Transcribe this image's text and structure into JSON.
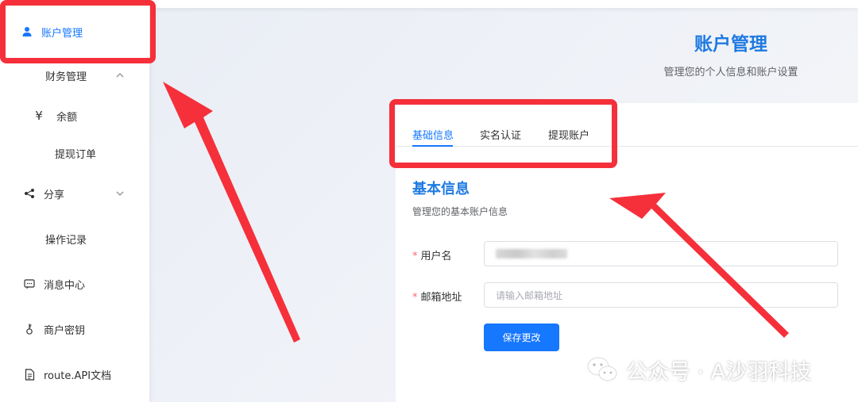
{
  "sidebar": {
    "items": [
      {
        "label": "账户管理",
        "icon": "user-icon",
        "active": true
      },
      {
        "label": "财务管理",
        "icon": "",
        "expandable": true,
        "expanded": true
      },
      {
        "label": "余额",
        "icon": "yen-icon",
        "glyph": "¥"
      },
      {
        "label": "提现订单",
        "icon": ""
      },
      {
        "label": "分享",
        "icon": "share-icon",
        "expandable": true,
        "expanded": false
      },
      {
        "label": "操作记录",
        "icon": ""
      },
      {
        "label": "消息中心",
        "icon": "message-icon"
      },
      {
        "label": "商户密钥",
        "icon": "key-icon"
      },
      {
        "label": "route.API文档",
        "icon": "document-icon"
      }
    ]
  },
  "header": {
    "title": "账户管理",
    "subtitle": "管理您的个人信息和账户设置"
  },
  "tabs": [
    {
      "label": "基础信息",
      "active": true
    },
    {
      "label": "实名认证",
      "active": false
    },
    {
      "label": "提现账户",
      "active": false
    }
  ],
  "section": {
    "title": "基本信息",
    "subtitle": "管理您的基本账户信息"
  },
  "form": {
    "username": {
      "label": "用户名",
      "required": true,
      "value_blurred": true
    },
    "email": {
      "label": "邮箱地址",
      "required": true,
      "placeholder": "请输入邮箱地址"
    },
    "save_label": "保存更改"
  },
  "watermark": {
    "text": "公众号 · A沙羽科技"
  },
  "colors": {
    "accent": "#1677ff",
    "title_blue": "#1f7ae0",
    "annotation_red": "#f5303a",
    "required_red": "#f56c6c"
  }
}
